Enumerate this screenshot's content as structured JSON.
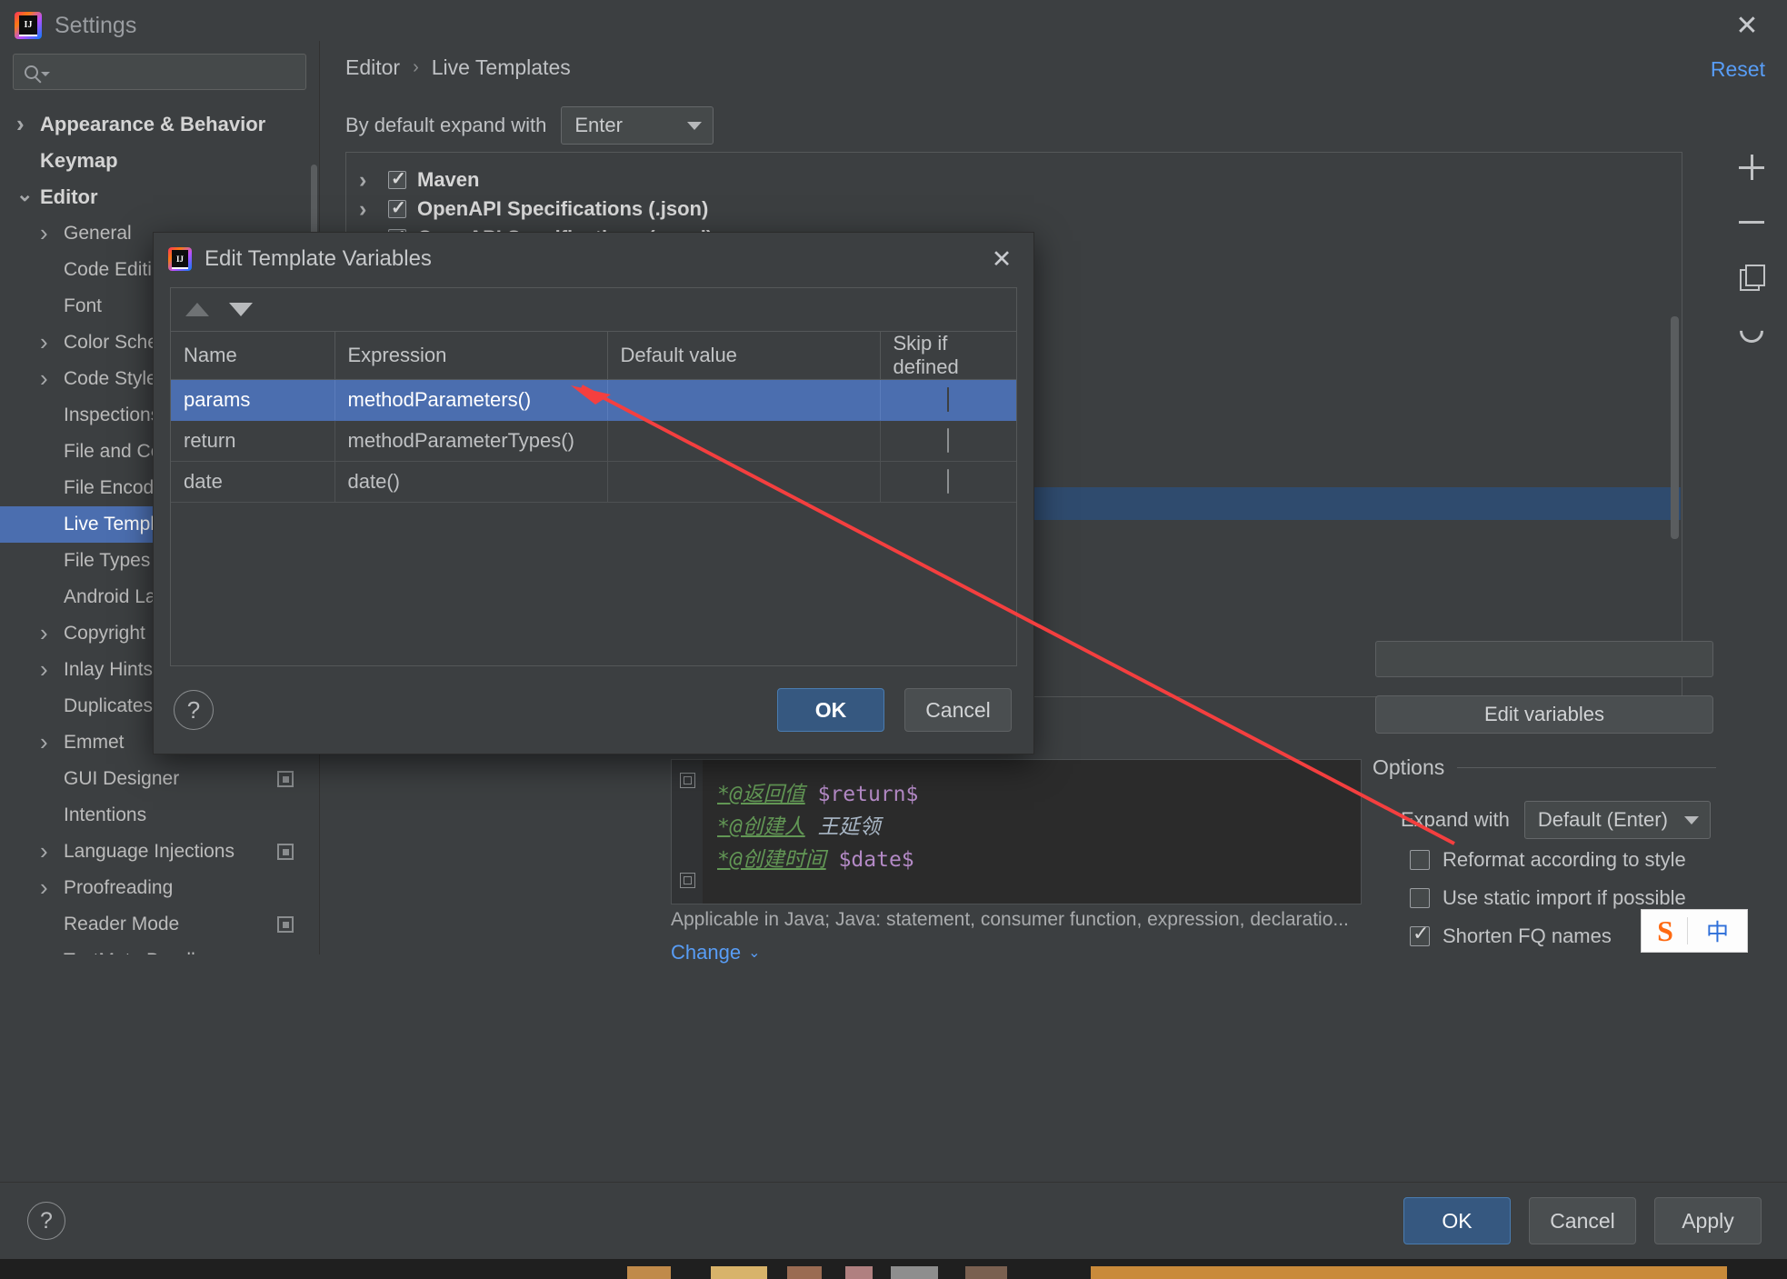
{
  "window": {
    "title": "Settings",
    "close_label": "✕",
    "logo_text": "IJ"
  },
  "sidebar": {
    "search_placeholder": "",
    "items": [
      {
        "label": "Appearance & Behavior",
        "level": 0,
        "twisty": "right",
        "bold": true,
        "selected": false,
        "badge": false
      },
      {
        "label": "Keymap",
        "level": 0,
        "twisty": "none",
        "bold": true,
        "selected": false,
        "badge": false
      },
      {
        "label": "Editor",
        "level": 0,
        "twisty": "down",
        "bold": true,
        "selected": false,
        "badge": false
      },
      {
        "label": "General",
        "level": 1,
        "twisty": "right",
        "bold": false,
        "selected": false,
        "badge": false
      },
      {
        "label": "Code Editing",
        "level": 1,
        "twisty": "none",
        "bold": false,
        "selected": false,
        "badge": false
      },
      {
        "label": "Font",
        "level": 1,
        "twisty": "none",
        "bold": false,
        "selected": false,
        "badge": false
      },
      {
        "label": "Color Scheme",
        "level": 1,
        "twisty": "right",
        "bold": false,
        "selected": false,
        "badge": false
      },
      {
        "label": "Code Style",
        "level": 1,
        "twisty": "right",
        "bold": false,
        "selected": false,
        "badge": false
      },
      {
        "label": "Inspections",
        "level": 1,
        "twisty": "none",
        "bold": false,
        "selected": false,
        "badge": false
      },
      {
        "label": "File and Code Templates",
        "level": 1,
        "twisty": "none",
        "bold": false,
        "selected": false,
        "badge": false
      },
      {
        "label": "File Encodings",
        "level": 1,
        "twisty": "none",
        "bold": false,
        "selected": false,
        "badge": false
      },
      {
        "label": "Live Templates",
        "level": 1,
        "twisty": "none",
        "bold": false,
        "selected": true,
        "badge": false
      },
      {
        "label": "File Types",
        "level": 1,
        "twisty": "none",
        "bold": false,
        "selected": false,
        "badge": false
      },
      {
        "label": "Android Layout Editor",
        "level": 1,
        "twisty": "none",
        "bold": false,
        "selected": false,
        "badge": false
      },
      {
        "label": "Copyright",
        "level": 1,
        "twisty": "right",
        "bold": false,
        "selected": false,
        "badge": false
      },
      {
        "label": "Inlay Hints",
        "level": 1,
        "twisty": "right",
        "bold": false,
        "selected": false,
        "badge": false
      },
      {
        "label": "Duplicates",
        "level": 1,
        "twisty": "none",
        "bold": false,
        "selected": false,
        "badge": false
      },
      {
        "label": "Emmet",
        "level": 1,
        "twisty": "right",
        "bold": false,
        "selected": false,
        "badge": false
      },
      {
        "label": "GUI Designer",
        "level": 1,
        "twisty": "none",
        "bold": false,
        "selected": false,
        "badge": true
      },
      {
        "label": "Intentions",
        "level": 1,
        "twisty": "none",
        "bold": false,
        "selected": false,
        "badge": false
      },
      {
        "label": "Language Injections",
        "level": 1,
        "twisty": "right",
        "bold": false,
        "selected": false,
        "badge": true
      },
      {
        "label": "Proofreading",
        "level": 1,
        "twisty": "right",
        "bold": false,
        "selected": false,
        "badge": false
      },
      {
        "label": "Reader Mode",
        "level": 1,
        "twisty": "none",
        "bold": false,
        "selected": false,
        "badge": true
      },
      {
        "label": "TextMate Bundles",
        "level": 1,
        "twisty": "none",
        "bold": false,
        "selected": false,
        "badge": false
      }
    ]
  },
  "main": {
    "breadcrumb": {
      "parent": "Editor",
      "separator": "›",
      "current": "Live Templates"
    },
    "reset_label": "Reset",
    "expand_with_label": "By default expand with",
    "expand_with_value": "Enter",
    "template_groups": [
      {
        "label": "Maven",
        "checked": true
      },
      {
        "label": "OpenAPI Specifications (.json)",
        "checked": true
      },
      {
        "label": "OpenAPI Specifications (.yaml)",
        "checked": true
      }
    ],
    "toolbar_icons": [
      "plus-icon",
      "minus-icon",
      "duplicate-icon",
      "revert-icon"
    ],
    "code_lines": [
      {
        "tag": "*@返回值",
        "value": "$return$",
        "kind": "var"
      },
      {
        "tag": "*@创建人",
        "value": "王延领",
        "kind": "text"
      },
      {
        "tag": "*@创建时间",
        "value": "$date$",
        "kind": "var"
      }
    ],
    "applicable_text": "Applicable in Java; Java: statement, consumer function, expression, declaratio...",
    "change_label": "Change",
    "change_caret": "⌄"
  },
  "right_panel": {
    "edit_variables_label": "Edit variables",
    "edit_variables_mnemonic": "E",
    "options_title": "Options",
    "expand_with_label": "Expand with",
    "expand_with_value": "Default (Enter)",
    "checkboxes": [
      {
        "label": "Reformat according to style",
        "checked": false
      },
      {
        "label": "Use static import if possible",
        "checked": false
      },
      {
        "label": "Shorten FQ names",
        "checked": true
      }
    ]
  },
  "ime_widget": {
    "logo": "S",
    "mode": "中"
  },
  "dialog": {
    "title": "Edit Template Variables",
    "close_label": "✕",
    "sort_up_icon": "triangle-up-icon",
    "sort_down_icon": "triangle-down-icon",
    "columns": [
      "Name",
      "Expression",
      "Default value",
      "Skip if defined"
    ],
    "rows": [
      {
        "name": "params",
        "expression": "methodParameters()",
        "default_value": "",
        "skip_if_defined": false,
        "selected": true
      },
      {
        "name": "return",
        "expression": "methodParameterTypes()",
        "default_value": "",
        "skip_if_defined": false,
        "selected": false
      },
      {
        "name": "date",
        "expression": "date()",
        "default_value": "",
        "skip_if_defined": false,
        "selected": false
      }
    ],
    "help_label": "?",
    "ok_label": "OK",
    "cancel_label": "Cancel"
  },
  "bottom_bar": {
    "help_label": "?",
    "ok_label": "OK",
    "cancel_label": "Cancel",
    "apply_label": "Apply",
    "apply_mnemonic": "A"
  },
  "colors": {
    "accent_selection": "#4b6eaf",
    "primary_button": "#365880",
    "link": "#589df6",
    "annotation_arrow": "#f43f3f",
    "background": "#3c3f41",
    "editor_background": "#2b2b2b"
  }
}
